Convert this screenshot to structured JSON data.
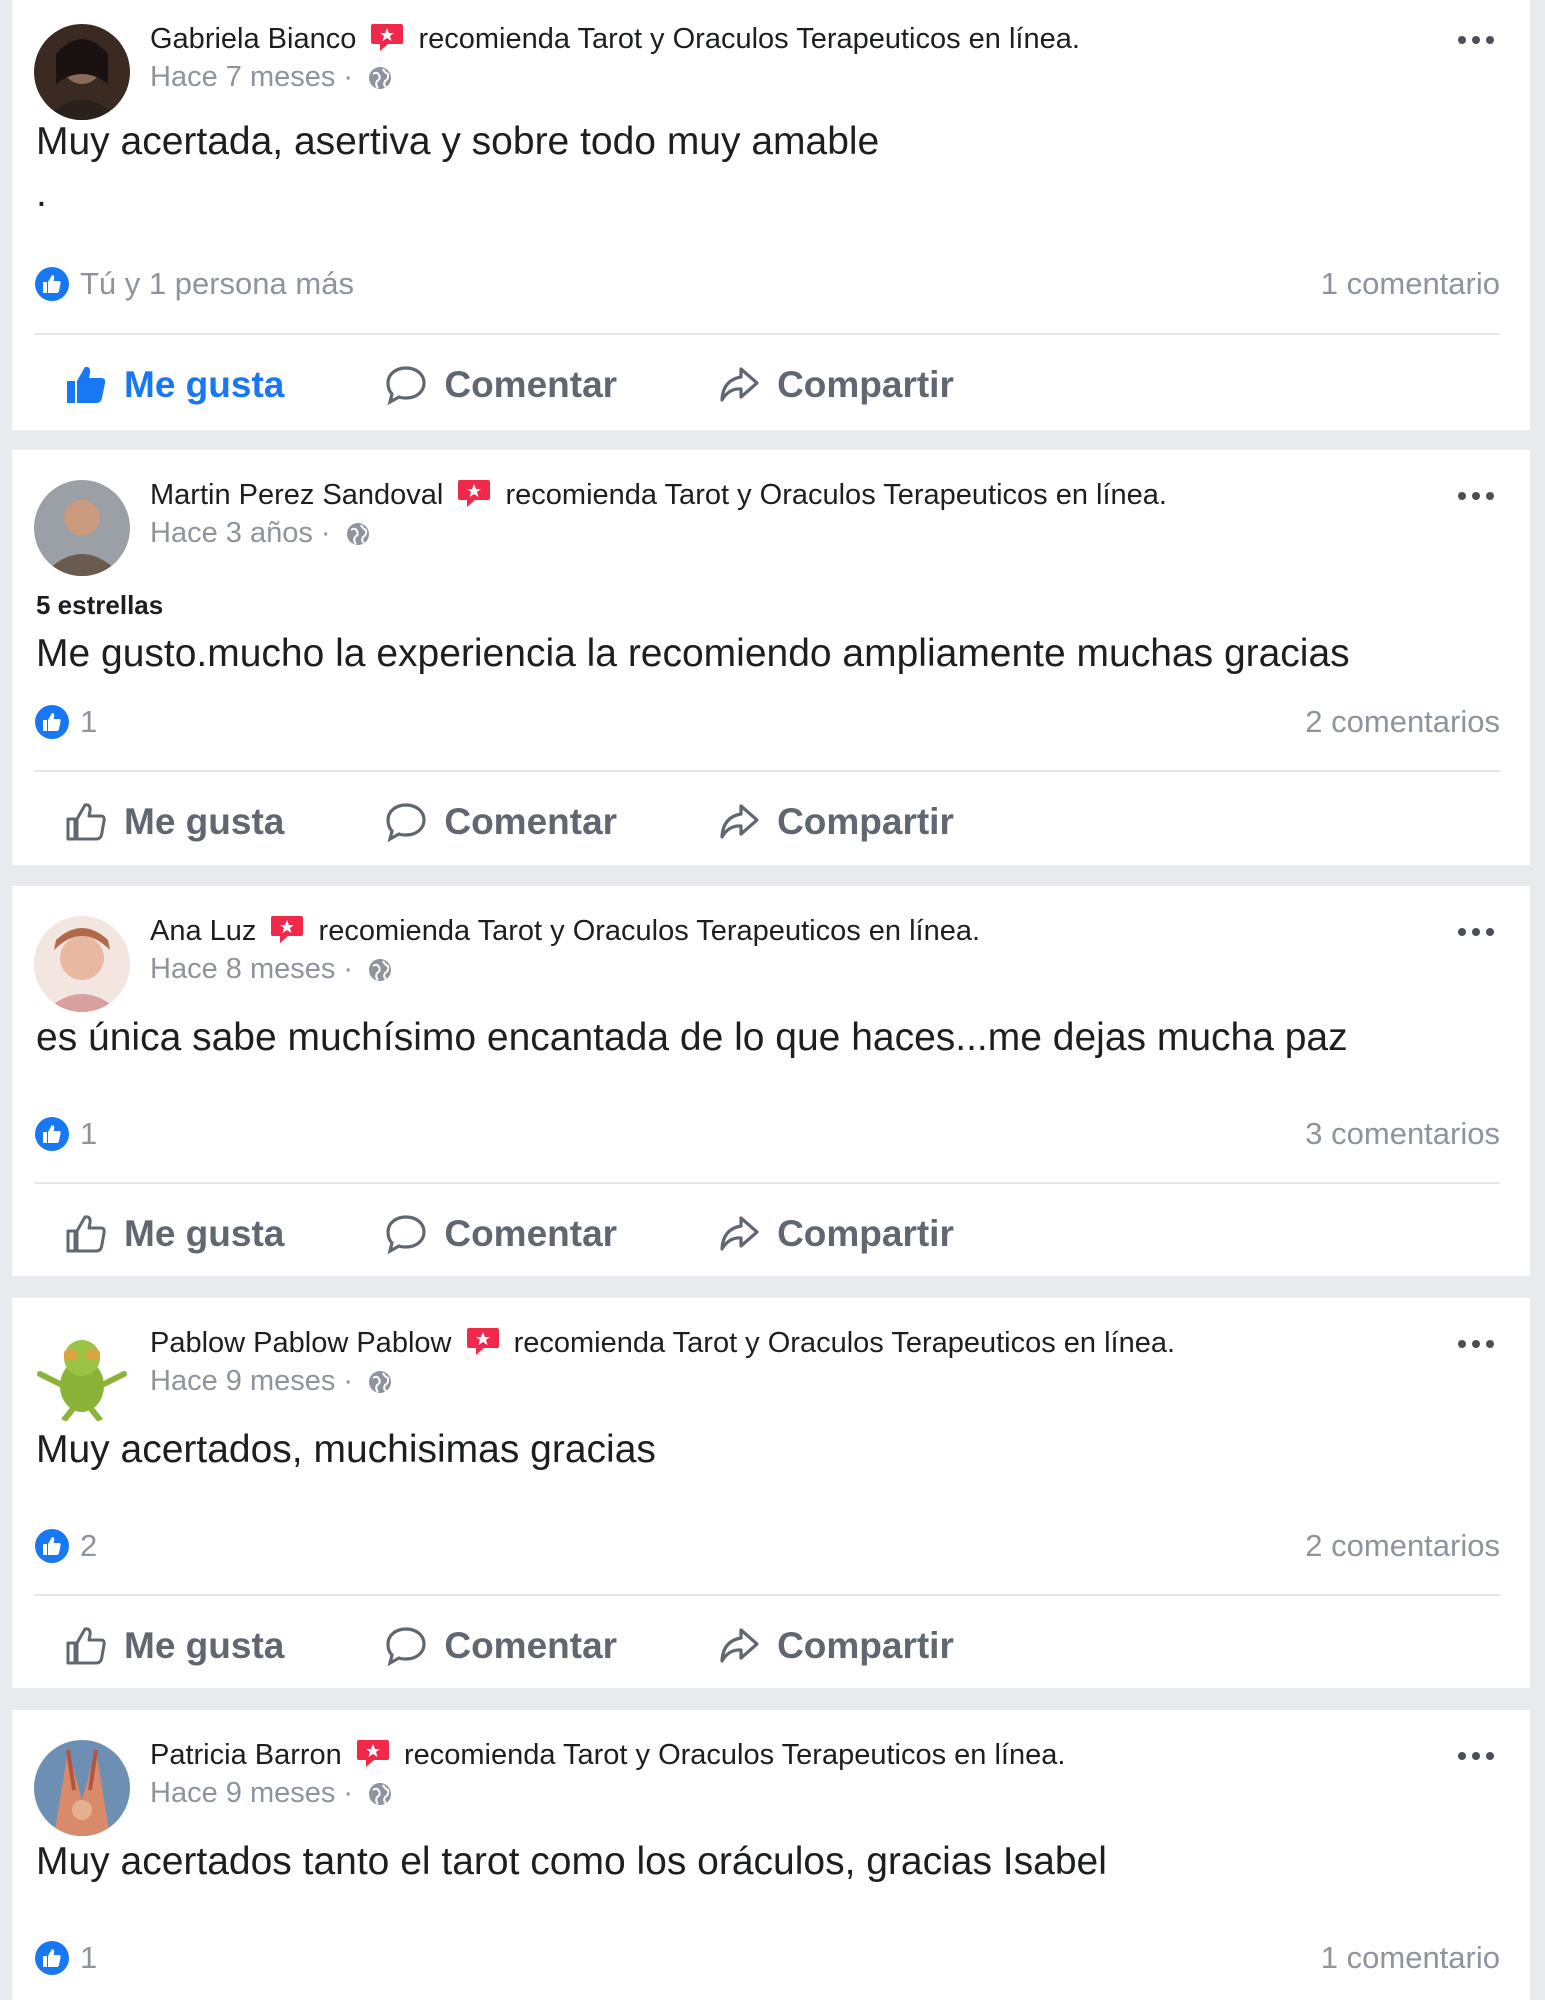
{
  "recommend_text": "recomienda Tarot y Oraculos Terapeuticos en línea.",
  "actions": {
    "like": "Me gusta",
    "comment": "Comentar",
    "share": "Compartir"
  },
  "colors": {
    "accent": "#1877f2",
    "recommend_icon": "#f02849",
    "muted": "#8d949e"
  },
  "posts": [
    {
      "author": "Gabriela Bianco",
      "time": "Hace 7 meses",
      "rating": "",
      "body": "Muy acertada, asertiva y sobre todo muy amable",
      "body2": ".",
      "likes": "Tú y 1 persona más",
      "comments": "1 comentario",
      "liked": true
    },
    {
      "author": "Martin Perez Sandoval",
      "time": "Hace 3 años",
      "rating": "5 estrellas",
      "body": "Me gusto.mucho la experiencia la recomiendo ampliamente muchas gracias",
      "likes": "1",
      "comments": "2 comentarios",
      "liked": false
    },
    {
      "author": "Ana Luz",
      "time": "Hace 8 meses",
      "rating": "",
      "body": "es única sabe muchísimo encantada de lo que haces...me dejas mucha paz",
      "likes": "1",
      "comments": "3 comentarios",
      "liked": false
    },
    {
      "author": "Pablow Pablow Pablow",
      "time": "Hace 9 meses",
      "rating": "",
      "body": "Muy acertados, muchisimas gracias",
      "likes": "2",
      "comments": "2 comentarios",
      "liked": false
    },
    {
      "author": "Patricia Barron",
      "time": "Hace 9 meses",
      "rating": "",
      "body": "Muy acertados tanto el tarot como los oráculos, gracias Isabel",
      "likes": "1",
      "comments": "1 comentario",
      "liked": false
    }
  ]
}
